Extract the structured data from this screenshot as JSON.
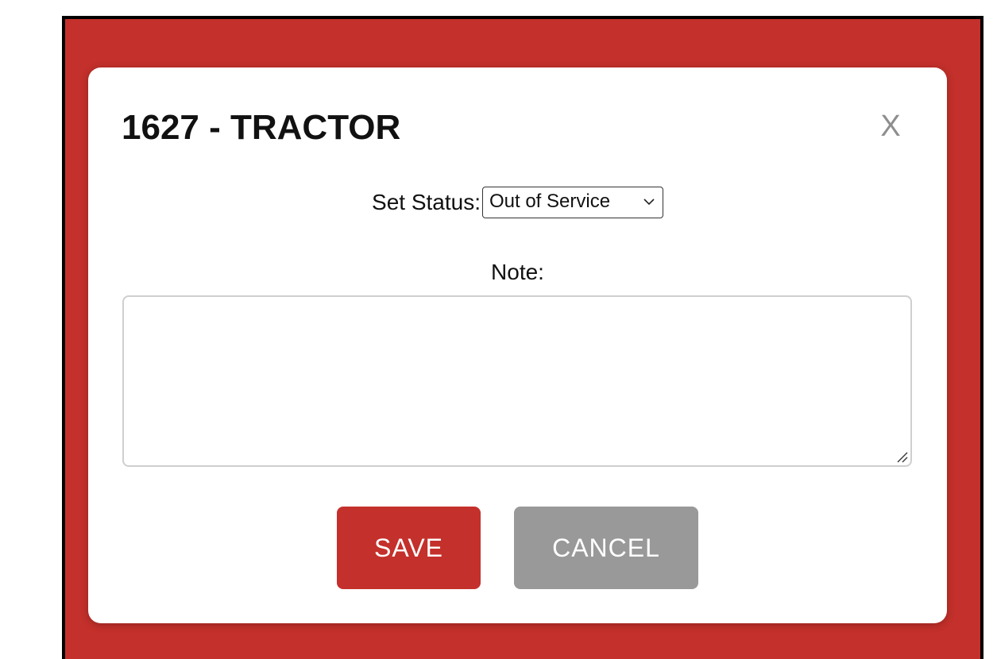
{
  "modal": {
    "title": "1627 - TRACTOR",
    "close_label": "X",
    "status": {
      "label": "Set Status:",
      "selected": "Out of Service"
    },
    "note": {
      "label": "Note:",
      "value": ""
    },
    "buttons": {
      "save_label": "SAVE",
      "cancel_label": "CANCEL"
    }
  },
  "colors": {
    "backdrop": "#c4302b",
    "save_button": "#c4302b",
    "cancel_button": "#999999",
    "close_icon": "#8e8e8e"
  },
  "icons": {
    "close": "close-icon",
    "select_arrow": "chevron-down-icon",
    "textarea_resize": "resize-handle-icon"
  }
}
